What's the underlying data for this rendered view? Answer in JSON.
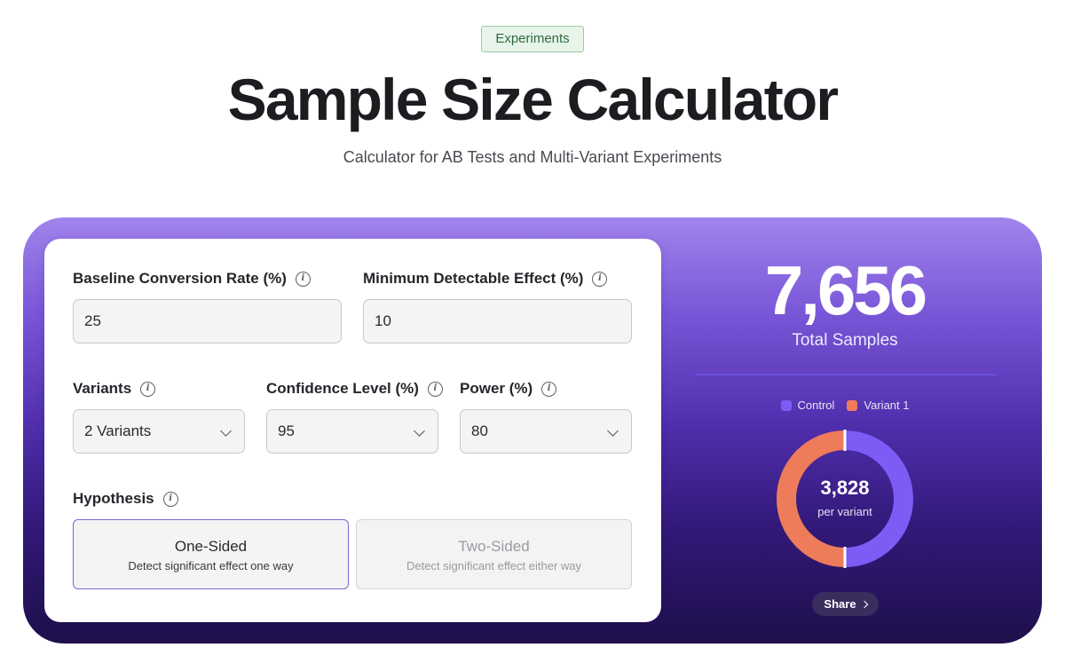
{
  "header": {
    "badge": "Experiments",
    "title": "Sample Size Calculator",
    "subtitle": "Calculator for AB Tests and Multi-Variant Experiments"
  },
  "form": {
    "baseline": {
      "label": "Baseline Conversion Rate (%)",
      "value": "25",
      "icon": "info-icon"
    },
    "mde": {
      "label": "Minimum Detectable Effect (%)",
      "value": "10",
      "icon": "info-icon"
    },
    "variants": {
      "label": "Variants",
      "value": "2 Variants",
      "icon": "info-icon"
    },
    "confidence": {
      "label": "Confidence Level (%)",
      "value": "95",
      "icon": "info-icon"
    },
    "power": {
      "label": "Power (%)",
      "value": "80",
      "icon": "info-icon"
    },
    "hypothesis": {
      "label": "Hypothesis",
      "icon": "info-icon",
      "selected": "One-Sided",
      "options": [
        {
          "title": "One-Sided",
          "desc": "Detect significant effect one way"
        },
        {
          "title": "Two-Sided",
          "desc": "Detect significant effect either way"
        }
      ]
    }
  },
  "results": {
    "total": "7,656",
    "total_label": "Total Samples",
    "legend": [
      {
        "label": "Control",
        "color": "#7c5cf5"
      },
      {
        "label": "Variant 1",
        "color": "#ee7c5a"
      }
    ],
    "split": [
      3828,
      3828
    ],
    "per_variant": "3,828",
    "per_variant_label": "per variant",
    "share_label": "Share"
  },
  "colors": {
    "accent": "#7c5cf5",
    "variant": "#ee7c5a",
    "badge_bg": "#e7f4ea"
  }
}
